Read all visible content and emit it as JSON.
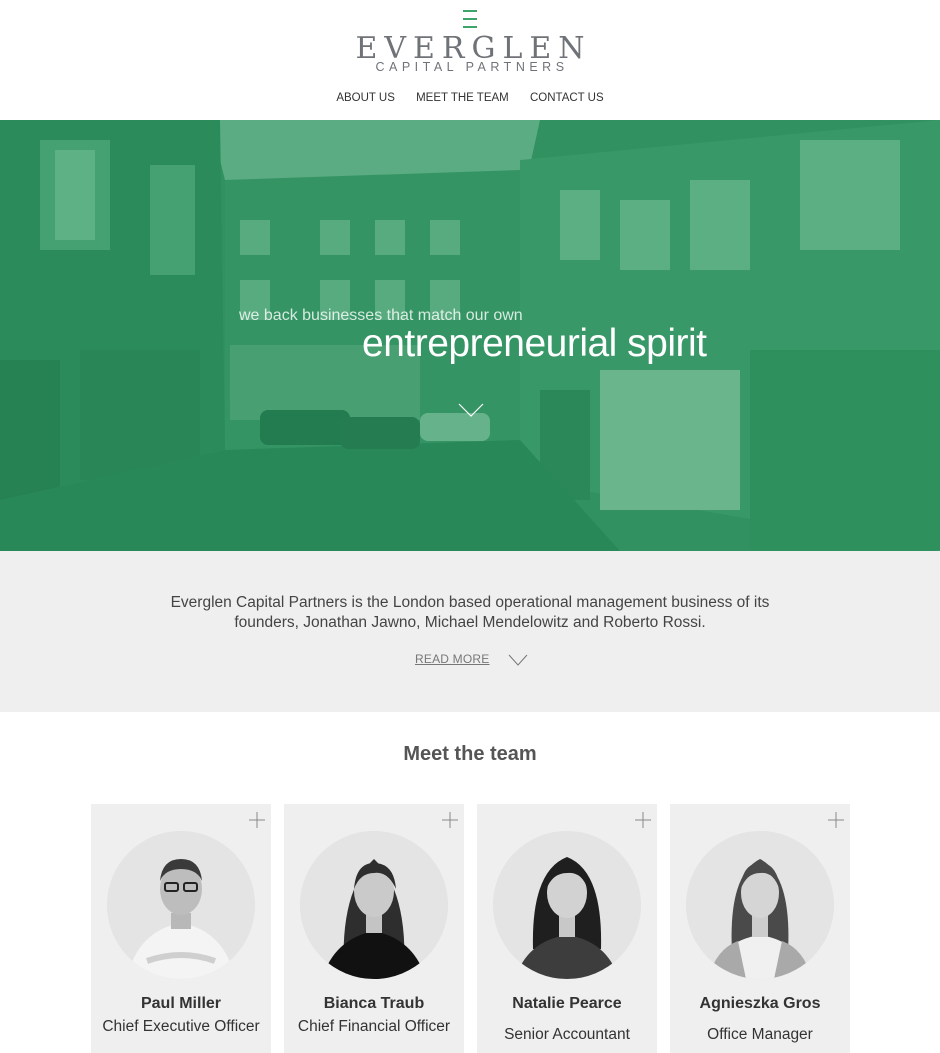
{
  "brand": {
    "name": "EVERGLEN",
    "tagline": "CAPITAL PARTNERS",
    "accent_color": "#3ea56a"
  },
  "nav": {
    "items": [
      {
        "label": "ABOUT US"
      },
      {
        "label": "MEET THE TEAM"
      },
      {
        "label": "CONTACT US"
      }
    ]
  },
  "hero": {
    "small_text": "we back businesses that match our own",
    "big_text": "entrepreneurial spirit",
    "overlay_color": "#2a8a5a",
    "arrow_icon": "chevron-down-icon"
  },
  "intro": {
    "text": "Everglen Capital Partners is the London based operational management business of its founders, Jonathan Jawno, Michael Mendelowitz and Roberto Rossi.",
    "read_more_label": "READ MORE"
  },
  "team": {
    "title": "Meet the team",
    "members": [
      {
        "name": "Paul Miller",
        "role": "Chief Executive Officer"
      },
      {
        "name": "Bianca Traub",
        "role": "Chief Financial Officer"
      },
      {
        "name": "Natalie Pearce",
        "role": "Senior Accountant"
      },
      {
        "name": "Agnieszka Gros",
        "role": "Office Manager"
      }
    ]
  }
}
